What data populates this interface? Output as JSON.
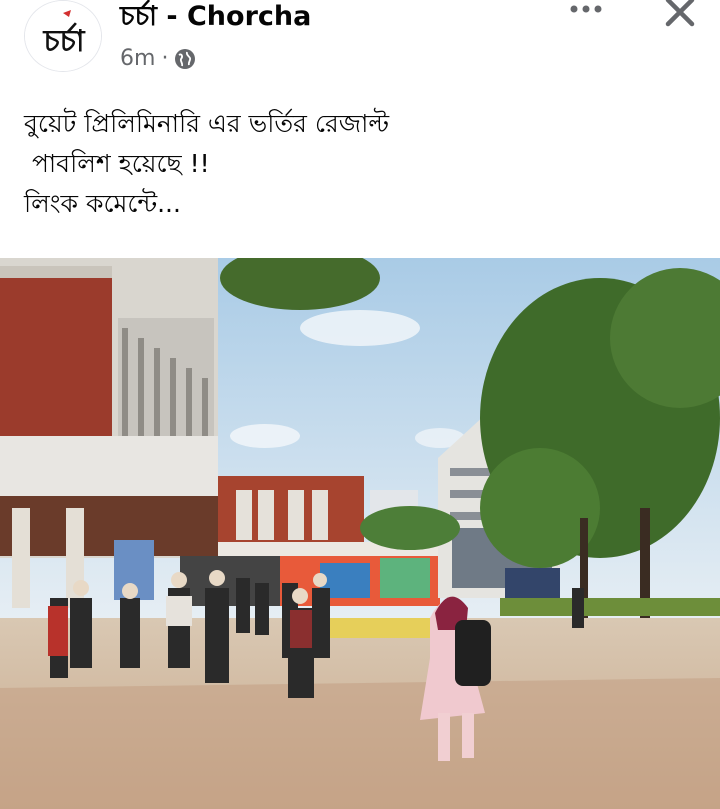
{
  "post": {
    "page_name": "চর্চা - Chorcha",
    "timestamp": "6m",
    "separator": "·",
    "privacy_icon": "globe-icon",
    "avatar_logo_text": "চর্চা",
    "text_lines": [
      "বুয়েট প্রিলিমিনারি এর ভর্তির রেজাল্ট",
      " পাবলিশ হয়েছে !!",
      "লিংক কমেন্টে..."
    ]
  },
  "actions": {
    "more_icon": "more-horizontal-icon",
    "close_icon": "close-icon"
  },
  "colors": {
    "name_text": "#050505",
    "meta_text": "#65676b",
    "logo_red": "#d32f2f",
    "sky": "#cfe3f2",
    "tree_green": "#3f6b2a",
    "brick": "#9b3b2c"
  }
}
